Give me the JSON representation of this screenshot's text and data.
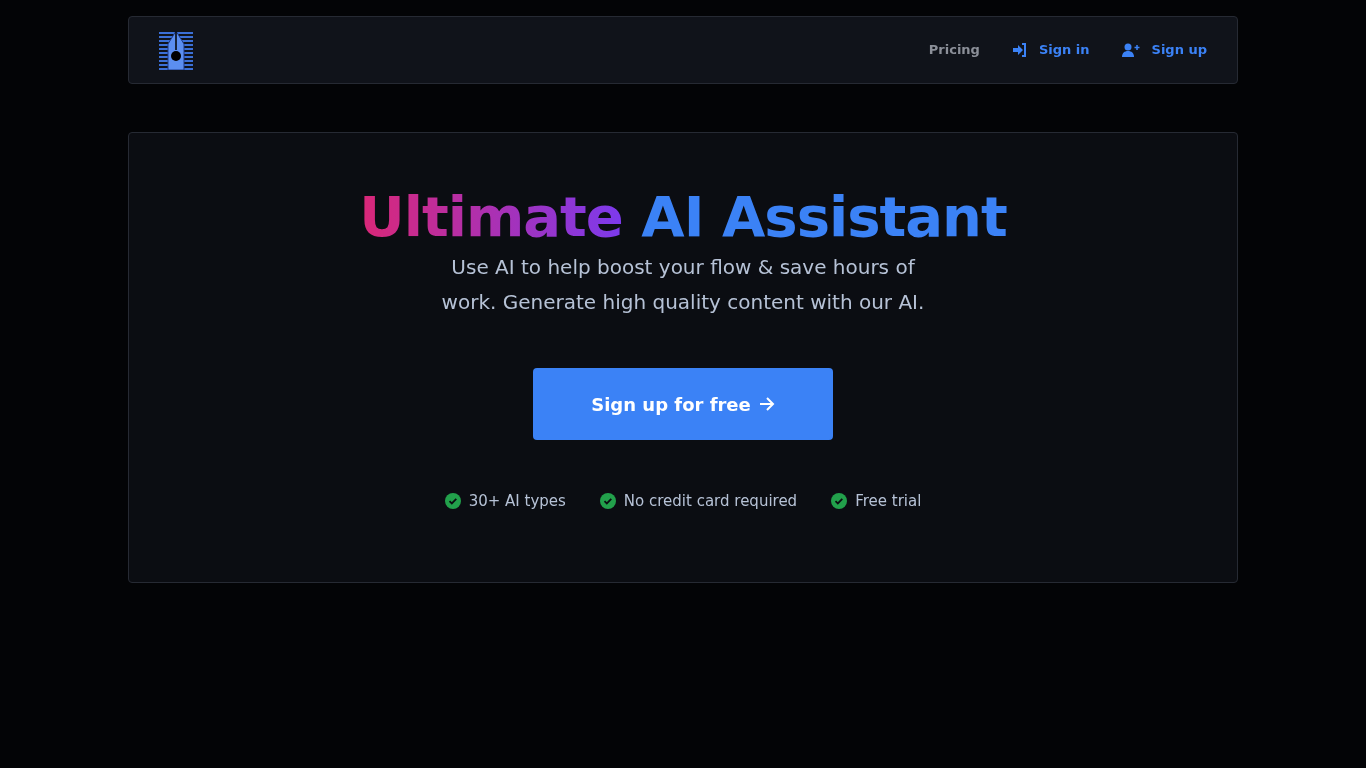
{
  "nav": {
    "links": [
      {
        "label": "Pricing",
        "kind": "plain"
      },
      {
        "label": "Sign in",
        "kind": "signin"
      },
      {
        "label": "Sign up",
        "kind": "signup"
      }
    ]
  },
  "hero": {
    "title_gradient": "Ultimate",
    "title_rest": "AI Assistant",
    "subtitle": "Use AI to help boost your flow & save hours of work. Generate high quality content with our AI.",
    "cta": "Sign up for free",
    "features": [
      "30+ AI types",
      "No credit card required",
      "Free trial"
    ]
  }
}
